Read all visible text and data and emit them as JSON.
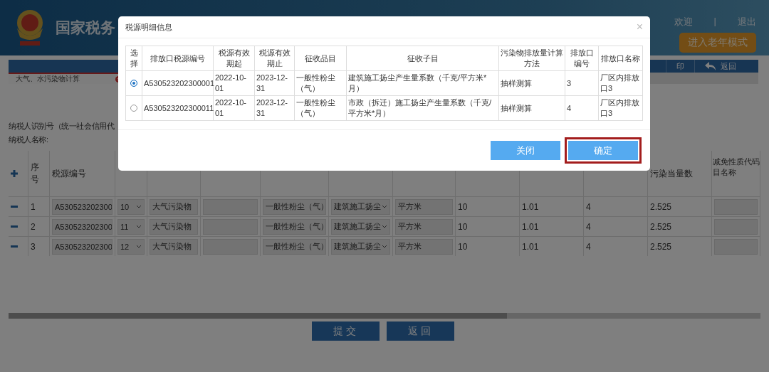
{
  "header": {
    "title": "国家税务",
    "welcome": "欢迎",
    "separator": "|",
    "logout": "退出",
    "elder_mode_button": "进入老年模式"
  },
  "toolbar": {
    "items": [
      {
        "kind": "print",
        "label": "印"
      },
      {
        "kind": "back",
        "label": "返回"
      }
    ]
  },
  "tabs": [
    {
      "label": "大气、水污染物计算",
      "selected": true
    }
  ],
  "form": {
    "taxpayer_id_label": "纳税人识别号（统一社会信用代",
    "taxpayer_name_label": "纳税人名称:"
  },
  "table": {
    "columns_left": [
      "序号",
      "税源编号"
    ],
    "columns_right": [
      "污染当量数",
      [
        "减免性质代码",
        "目名称"
      ]
    ],
    "rows": [
      {
        "index": "1",
        "tax_source_id": "A530523202300",
        "month": "10",
        "category": "大气污染物",
        "pollutant_item": "一般性粉尘（气）",
        "sub_item": "建筑施工扬尘",
        "unit": "平方米",
        "quantity": "10",
        "coefficient": "1.01",
        "column_12": "4",
        "pollution_equivalent": "2.525"
      },
      {
        "index": "2",
        "tax_source_id": "A530523202300",
        "month": "11",
        "category": "大气污染物",
        "pollutant_item": "一般性粉尘（气）",
        "sub_item": "建筑施工扬尘",
        "unit": "平方米",
        "quantity": "10",
        "coefficient": "1.01",
        "column_12": "4",
        "pollution_equivalent": "2.525"
      },
      {
        "index": "3",
        "tax_source_id": "A530523202300",
        "month": "12",
        "category": "大气污染物",
        "pollutant_item": "一般性粉尘（气）",
        "sub_item": "建筑施工扬尘",
        "unit": "平方米",
        "quantity": "10",
        "coefficient": "1.01",
        "column_12": "4",
        "pollution_equivalent": "2.525"
      }
    ]
  },
  "actions": [
    "提交",
    "返回"
  ],
  "dialog": {
    "title": "税源明细信息",
    "close": "×",
    "columns": [
      "选择",
      "排放口税源编号",
      "税源有效期起",
      "税源有效期止",
      "征收品目",
      "征收子目",
      "污染物排放量计算方法",
      "排放口编号",
      "排放口名称"
    ],
    "rows": [
      {
        "selected": true,
        "source_id": "A530523202300001",
        "valid_from": "2022-10-01",
        "valid_to": "2023-12-31",
        "item": "一般性粉尘（气）",
        "sub_item": "建筑施工扬尘产生量系数（千克/平方米*月）",
        "method": "抽样测算",
        "outlet_no": "3",
        "outlet_name": "厂区内排放口3"
      },
      {
        "selected": false,
        "source_id": "A530523202300011",
        "valid_from": "2022-10-01",
        "valid_to": "2023-12-31",
        "item": "一般性粉尘（气）",
        "sub_item": "市政（拆迁）施工扬尘产生量系数（千克/ 平方米*月）",
        "method": "抽样测算",
        "outlet_no": "4",
        "outlet_name": "厂区内排放口3"
      }
    ],
    "buttons": [
      {
        "label": "关闭",
        "highlighted": false
      },
      {
        "label": "确定",
        "highlighted": true
      }
    ]
  }
}
